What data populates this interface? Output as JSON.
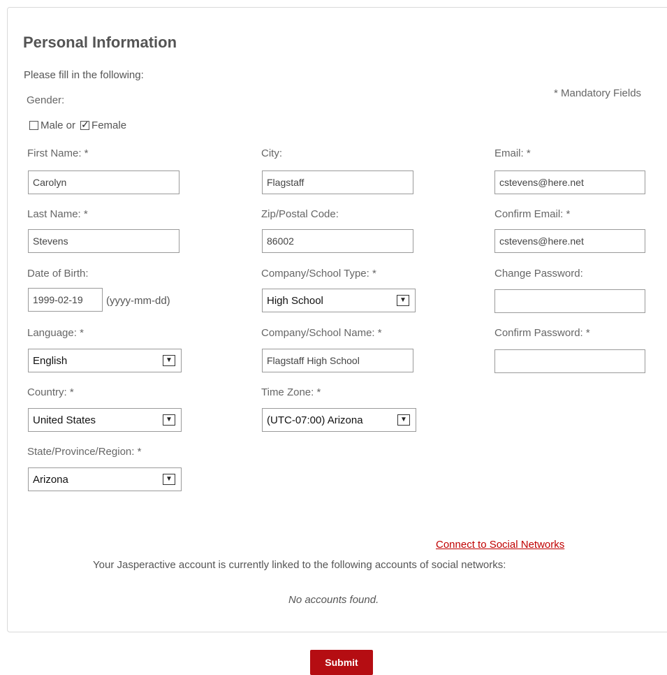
{
  "form": {
    "title": "Personal Information",
    "subtitle": "Please fill in the following:",
    "mandatory_note": "* Mandatory Fields",
    "gender": {
      "label": "Gender:",
      "male_label": "Male or",
      "female_label": "Female",
      "male_checked": false,
      "female_checked": true
    },
    "fields": {
      "first_name": {
        "label": "First Name: *",
        "value": "Carolyn"
      },
      "last_name": {
        "label": "Last Name: *",
        "value": "Stevens"
      },
      "dob": {
        "label": "Date of Birth:",
        "value": "1999-02-19",
        "hint": "(yyyy-mm-dd)"
      },
      "language": {
        "label": "Language: *",
        "value": "English"
      },
      "country": {
        "label": "Country: *",
        "value": "United States"
      },
      "state": {
        "label": "State/Province/Region: *",
        "value": "Arizona"
      },
      "city": {
        "label": "City:",
        "value": "Flagstaff"
      },
      "zip": {
        "label": "Zip/Postal Code:",
        "value": "86002"
      },
      "school_type": {
        "label": "Company/School Type: *",
        "value": "High School"
      },
      "school_name": {
        "label": "Company/School Name: *",
        "value": "Flagstaff High School"
      },
      "time_zone": {
        "label": "Time Zone: *",
        "value": "(UTC-07:00) Arizona"
      },
      "email": {
        "label": "Email: *",
        "value": "cstevens@here.net"
      },
      "confirm_email": {
        "label": "Confirm Email: *",
        "value": "cstevens@here.net"
      },
      "change_password": {
        "label": "Change Password:",
        "value": ""
      },
      "confirm_password": {
        "label": "Confirm Password: *",
        "value": ""
      }
    }
  },
  "social": {
    "link_label": "Connect to Social Networks",
    "description": "Your Jasperactive account is currently linked to the following accounts of social networks:",
    "empty_text": "No accounts found."
  },
  "actions": {
    "submit_label": "Submit"
  },
  "colors": {
    "accent_red": "#b50d12",
    "link_red": "#c00000"
  },
  "icons": {
    "checkmark": "check-icon",
    "dropdown": "chevron-down-icon"
  }
}
